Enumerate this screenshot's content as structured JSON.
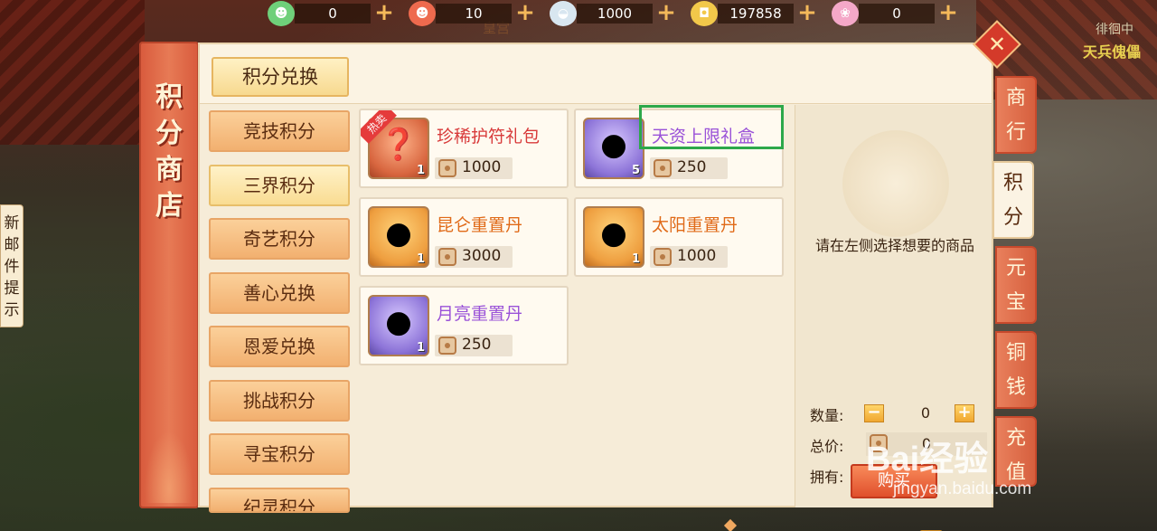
{
  "resources": [
    {
      "icon": "green-token-icon",
      "value": "0",
      "color": "#6fd07a",
      "glyph": "☻"
    },
    {
      "icon": "red-token-icon",
      "value": "10",
      "color": "#ee6a4e",
      "glyph": "☻"
    },
    {
      "icon": "silver-ingot-icon",
      "value": "1000",
      "color": "#d8e6f0",
      "glyph": "◒"
    },
    {
      "icon": "gold-coin-icon",
      "value": "197858",
      "color": "#f2c84a",
      "glyph": "◘"
    },
    {
      "icon": "pink-pet-icon",
      "value": "0",
      "color": "#f4a8c8",
      "glyph": "❀"
    }
  ],
  "background": {
    "top_label": "皇宫",
    "right_label_1": "徘徊中",
    "right_label_2": "天兵傀儡"
  },
  "shop": {
    "title": "积分商店",
    "header_tab": "积分兑换",
    "categories": [
      {
        "label": "竞技积分",
        "active": false
      },
      {
        "label": "三界积分",
        "active": true
      },
      {
        "label": "奇艺积分",
        "active": false
      },
      {
        "label": "善心兑换",
        "active": false
      },
      {
        "label": "恩爱兑换",
        "active": false
      },
      {
        "label": "挑战积分",
        "active": false
      },
      {
        "label": "寻宝积分",
        "active": false
      },
      {
        "label": "纪灵积分",
        "active": false
      }
    ],
    "items": [
      {
        "name": "珍稀护符礼包",
        "price": "1000",
        "qty": "1",
        "rarity": "red",
        "badge": "热卖",
        "glyph": "❓"
      },
      {
        "name": "天资上限礼盒",
        "price": "250",
        "qty": "5",
        "rarity": "purple",
        "badge": "",
        "glyph": "●"
      },
      {
        "name": "昆仑重置丹",
        "price": "3000",
        "qty": "1",
        "rarity": "orange",
        "badge": "",
        "glyph": "●"
      },
      {
        "name": "太阳重置丹",
        "price": "1000",
        "qty": "1",
        "rarity": "orange",
        "badge": "",
        "glyph": "●"
      },
      {
        "name": "月亮重置丹",
        "price": "250",
        "qty": "1",
        "rarity": "purple",
        "badge": "",
        "glyph": "●"
      }
    ],
    "detail": {
      "hint": "请在左侧选择想要的商品",
      "quantity_label": "数量:",
      "quantity_value": "0",
      "total_label": "总价:",
      "total_value": "0",
      "owned_label": "拥有:",
      "owned_value": "0",
      "buy_label": "购买"
    },
    "help_label": "?"
  },
  "side_tabs": [
    {
      "label": "商行",
      "active": false
    },
    {
      "label": "积分",
      "active": true
    },
    {
      "label": "元宝",
      "active": false
    },
    {
      "label": "铜钱",
      "active": false
    },
    {
      "label": "充值",
      "active": false
    }
  ],
  "close_label": "✕",
  "mail_notice": "新邮件提示",
  "watermark": {
    "main": "Bai经验",
    "sub": "jingyan.baidu.com"
  }
}
